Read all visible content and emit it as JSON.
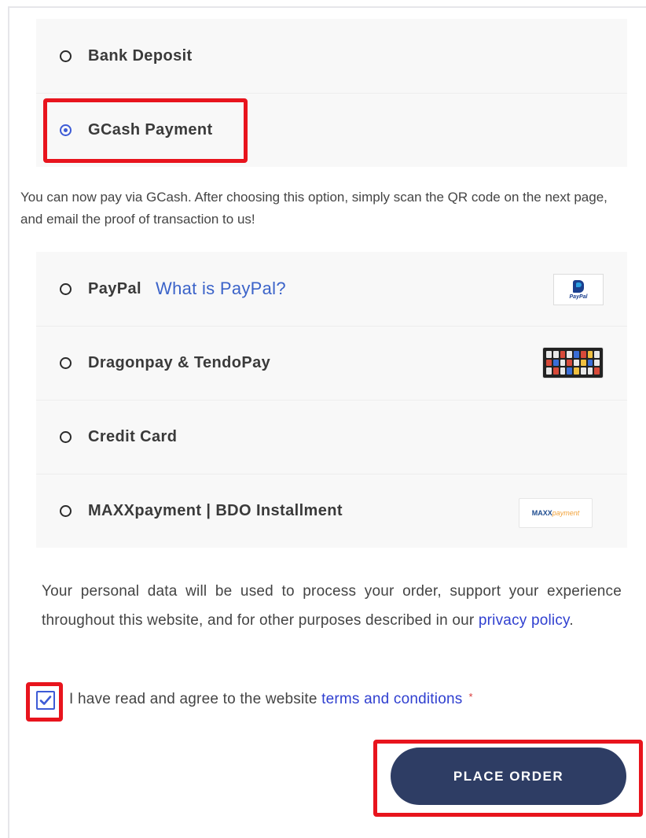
{
  "payment_methods": [
    {
      "label": "Bank Deposit",
      "selected": false
    },
    {
      "label": "GCash Payment",
      "selected": true
    },
    {
      "label": "PayPal",
      "selected": false,
      "link": "What is PayPal?",
      "logo_text": "PayPal"
    },
    {
      "label": "Dragonpay & TendoPay",
      "selected": false
    },
    {
      "label": "Credit Card",
      "selected": false
    },
    {
      "label": "MAXXpayment | BDO Installment",
      "selected": false,
      "logo_text_a": "MAXX",
      "logo_text_b": "payment"
    }
  ],
  "gcash_description": "You can now pay via GCash. After choosing this option, simply scan the QR code on the next page, and email the proof of transaction to us!",
  "privacy": {
    "text_before": "Your personal data will be used to process your order, support your experience throughout this website, and for other purposes described in our ",
    "link": "privacy policy",
    "text_after": "."
  },
  "terms": {
    "checked": true,
    "text": "I have read and agree to the website ",
    "link": "terms and conditions",
    "required_mark": "*"
  },
  "place_order_label": "PLACE ORDER",
  "colors": {
    "accent": "#3d5bd6",
    "button": "#2e3d64",
    "highlight": "#e8141d",
    "link": "#3b63c9"
  }
}
